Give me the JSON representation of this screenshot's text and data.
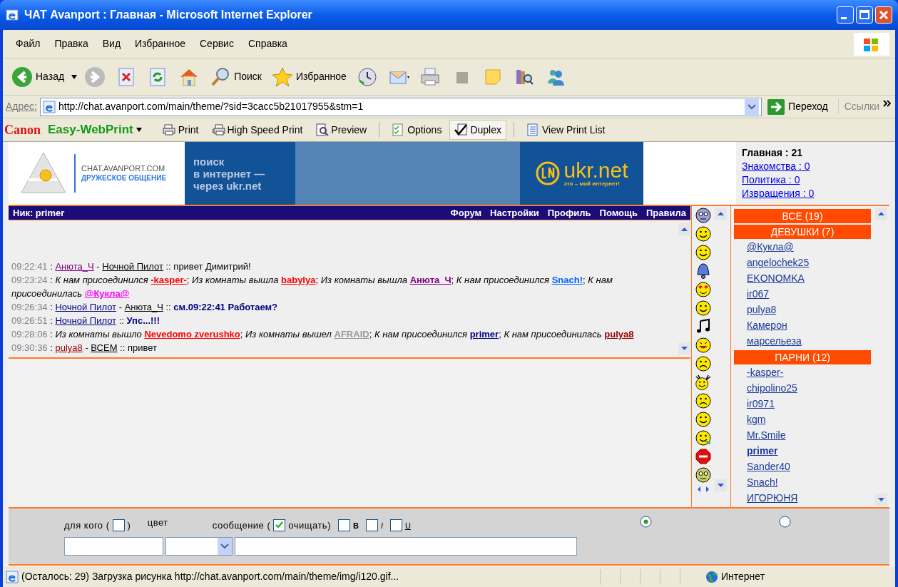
{
  "window": {
    "title": "ЧАТ Avanport : Главная - Microsoft Internet Explorer"
  },
  "menu": [
    "Файл",
    "Правка",
    "Вид",
    "Избранное",
    "Сервис",
    "Справка"
  ],
  "toolbar": [
    {
      "kind": "back",
      "label": "Назад"
    },
    {
      "kind": "forward"
    },
    {
      "kind": "stop"
    },
    {
      "kind": "refresh"
    },
    {
      "kind": "home"
    },
    {
      "kind": "search",
      "label": "Поиск"
    },
    {
      "kind": "favorites",
      "label": "Избранное"
    },
    {
      "kind": "history"
    },
    {
      "kind": "mail"
    },
    {
      "kind": "print"
    },
    {
      "kind": "edit"
    },
    {
      "kind": "note"
    },
    {
      "kind": "research"
    },
    {
      "kind": "messenger"
    }
  ],
  "address": {
    "label": "Адрес:",
    "url": "http://chat.avanport.com/main/theme/?sid=3cacc5b21017955&stm=1",
    "go": "Переход",
    "links": "Ссылки"
  },
  "print_toolbar": {
    "brand": "Canon",
    "product": "Easy-WebPrint",
    "buttons": [
      {
        "label": "Print",
        "selected": false
      },
      {
        "label": "High Speed Print",
        "selected": false
      },
      {
        "label": "Preview",
        "selected": false
      },
      {
        "label": "Options",
        "selected": false
      },
      {
        "label": "Duplex",
        "selected": true
      },
      {
        "label": "View Print List",
        "selected": false
      }
    ]
  },
  "banner": {
    "site": "CHAT.AVANPORT.COM",
    "tagline": "ДРУЖЕСКОЕ ОБЩЕНИЕ",
    "ad_lines": [
      "поиск",
      "в интернет —",
      "через ukr.net"
    ],
    "ad_logo": "ukr.net",
    "ad_slogan": "это – мой интернет!"
  },
  "rooms": [
    {
      "label": "Главная : 21",
      "selected": true
    },
    {
      "label": "Знакомства : 0",
      "selected": false
    },
    {
      "label": "Политика : 0",
      "selected": false
    },
    {
      "label": "Извращения : 0",
      "selected": false
    }
  ],
  "chat_header": {
    "nick": "Ник: primer",
    "links": [
      "Форум",
      "Настройки",
      "Профиль",
      "Помощь",
      "Правила"
    ]
  },
  "messages": [
    [
      {
        "kind": "time",
        "text": "09:22:41"
      },
      {
        "kind": "text",
        "text": " : "
      },
      {
        "kind": "nick",
        "text": "Анюта_Ч",
        "color": "#800080"
      },
      {
        "kind": "text",
        "text": " - "
      },
      {
        "kind": "nick",
        "text": "Ночной Пилот",
        "color": "#000000"
      },
      {
        "kind": "text",
        "text": " :: привет Димитрий!"
      }
    ],
    [
      {
        "kind": "time",
        "text": "09:23:24"
      },
      {
        "kind": "text",
        "text": " : "
      },
      {
        "kind": "system",
        "text": "К нам присоединился "
      },
      {
        "kind": "nick_bold",
        "text": "-kasper-",
        "color": "#ff0000"
      },
      {
        "kind": "text",
        "text": "; "
      },
      {
        "kind": "system",
        "text": "Из комнаты вышла "
      },
      {
        "kind": "nick_bold",
        "text": "babylya",
        "color": "#ff0000"
      },
      {
        "kind": "text",
        "text": "; "
      },
      {
        "kind": "system",
        "text": "Из комнаты вышла "
      },
      {
        "kind": "nick_bold",
        "text": "Анюта_Ч",
        "color": "#800080"
      },
      {
        "kind": "text",
        "text": "; "
      },
      {
        "kind": "system",
        "text": "К нам присоединился "
      },
      {
        "kind": "nick_bold",
        "text": "Snach!",
        "color": "#0066ff"
      },
      {
        "kind": "text",
        "text": "; "
      },
      {
        "kind": "system",
        "text": "К нам присоединилась "
      },
      {
        "kind": "nick_bold",
        "text": "@Кукла@",
        "color": "#ff00ff"
      }
    ],
    [
      {
        "kind": "time",
        "text": "09:26:34"
      },
      {
        "kind": "text",
        "text": " : "
      },
      {
        "kind": "nick",
        "text": "Ночной Пилот",
        "color": "#000080"
      },
      {
        "kind": "text",
        "text": " - "
      },
      {
        "kind": "nick",
        "text": "Анюта_Ч",
        "color": "#000000"
      },
      {
        "kind": "text",
        "text": " :: "
      },
      {
        "kind": "bold",
        "text": "см.09:22:41 Работаем?"
      }
    ],
    [
      {
        "kind": "time",
        "text": "09:26:51"
      },
      {
        "kind": "text",
        "text": " : "
      },
      {
        "kind": "nick",
        "text": "Ночной Пилот",
        "color": "#000080"
      },
      {
        "kind": "text",
        "text": " :: "
      },
      {
        "kind": "bold",
        "text": "Упс...!!!"
      }
    ],
    [
      {
        "kind": "time",
        "text": "09:28:06"
      },
      {
        "kind": "text",
        "text": " : "
      },
      {
        "kind": "system",
        "text": "Из комнаты вышло "
      },
      {
        "kind": "nick_bold",
        "text": "Nevedomo zverushko",
        "color": "#ff0000"
      },
      {
        "kind": "text",
        "text": "; "
      },
      {
        "kind": "system",
        "text": "Из комнаты вышел "
      },
      {
        "kind": "nick_bold",
        "text": "AFRAID",
        "color": "#999999"
      },
      {
        "kind": "text",
        "text": "; "
      },
      {
        "kind": "system",
        "text": "К нам присоединился "
      },
      {
        "kind": "nick_bold",
        "text": "primer",
        "color": "#000080"
      },
      {
        "kind": "text",
        "text": "; "
      },
      {
        "kind": "system",
        "text": "К нам присоединилась "
      },
      {
        "kind": "nick_bold",
        "text": "pulya8",
        "color": "#990000"
      }
    ],
    [
      {
        "kind": "time",
        "text": "09:30:36"
      },
      {
        "kind": "text",
        "text": " : "
      },
      {
        "kind": "nick",
        "text": "pulya8",
        "color": "#990000"
      },
      {
        "kind": "text",
        "text": " - "
      },
      {
        "kind": "nick",
        "text": "ВСЕМ",
        "color": "#000000"
      },
      {
        "kind": "text",
        "text": " :: привет"
      }
    ]
  ],
  "user_groups": [
    {
      "label": "ВСЕ (19)"
    },
    {
      "label": "ДЕВУШКИ (7)",
      "users": [
        {
          "name": "@Кукла@",
          "self": false
        },
        {
          "name": "angelochek25",
          "self": false
        },
        {
          "name": "EKONOMKA",
          "self": false
        },
        {
          "name": "ir067",
          "self": false
        },
        {
          "name": "pulya8",
          "self": false
        },
        {
          "name": "Камерон",
          "self": false
        },
        {
          "name": "марсельеза",
          "self": false
        }
      ]
    },
    {
      "label": "ПАРНИ (12)",
      "users": [
        {
          "name": "-kasper-",
          "self": false
        },
        {
          "name": "chipolino25",
          "self": false
        },
        {
          "name": "ir0971",
          "self": false
        },
        {
          "name": "kgm",
          "self": false
        },
        {
          "name": "Mr.Smile",
          "self": false
        },
        {
          "name": "primer",
          "self": true
        },
        {
          "name": "Sander40",
          "self": false
        },
        {
          "name": "Snach!",
          "self": false
        },
        {
          "name": "ИГОРЮНЯ",
          "self": false
        }
      ]
    }
  ],
  "form": {
    "to_label": "для кого (",
    "to_close": ")",
    "to_checked": false,
    "color_label": "цвет",
    "message_label": "сообщение (",
    "clear_checked": true,
    "clear_label": "очищать)",
    "styles": [
      {
        "label": "B",
        "checked": false
      },
      {
        "label": "I",
        "checked": false
      },
      {
        "label": "U",
        "checked": false
      }
    ],
    "radios": [
      {
        "selected": true
      },
      {
        "selected": false
      }
    ]
  },
  "status_bar": {
    "text": "(Осталось: 29) Загрузка рисунка http://chat.avanport.com/main/theme/img/i120.gif...",
    "zone": "Интернет"
  }
}
